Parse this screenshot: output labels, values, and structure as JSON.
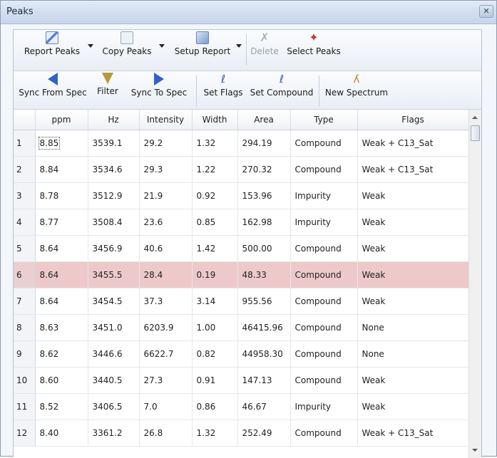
{
  "window": {
    "title": "Peaks"
  },
  "colors": {
    "selected_row": "#edc9c9",
    "accent": "#3a63c6"
  },
  "toolbar1": [
    {
      "label": "Report Peaks",
      "icon": "report-peaks-icon",
      "dropdown": true,
      "disabled": false
    },
    {
      "label": "Copy Peaks",
      "icon": "copy-peaks-icon",
      "dropdown": true,
      "disabled": false
    },
    {
      "label": "Setup Report",
      "icon": "setup-report-icon",
      "dropdown": true,
      "disabled": false
    },
    {
      "label": "Delete",
      "icon": "delete-icon",
      "dropdown": false,
      "disabled": true
    },
    {
      "label": "Select Peaks",
      "icon": "select-peaks-icon",
      "dropdown": false,
      "disabled": false
    }
  ],
  "toolbar2": [
    {
      "label": "Sync From Spec",
      "icon": "sync-from-spec-icon"
    },
    {
      "label": "Filter",
      "icon": "filter-icon"
    },
    {
      "label": "Sync To Spec",
      "icon": "sync-to-spec-icon"
    },
    {
      "label": "Set Flags",
      "icon": "set-flags-icon"
    },
    {
      "label": "Set Compound",
      "icon": "set-compound-icon"
    },
    {
      "label": "New Spectrum",
      "icon": "new-spectrum-icon"
    }
  ],
  "table": {
    "columns": [
      "",
      "ppm",
      "Hz",
      "Intensity",
      "Width",
      "Area",
      "Type",
      "Flags"
    ],
    "rows": [
      [
        "1",
        "8.85",
        "3539.1",
        "29.2",
        "1.32",
        "294.19",
        "Compound",
        "Weak + C13_Sat"
      ],
      [
        "2",
        "8.84",
        "3534.6",
        "29.3",
        "1.22",
        "270.32",
        "Compound",
        "Weak + C13_Sat"
      ],
      [
        "3",
        "8.78",
        "3512.9",
        "21.9",
        "0.92",
        "153.96",
        "Impurity",
        "Weak"
      ],
      [
        "4",
        "8.77",
        "3508.4",
        "23.6",
        "0.85",
        "162.98",
        "Impurity",
        "Weak"
      ],
      [
        "5",
        "8.64",
        "3456.9",
        "40.6",
        "1.42",
        "500.00",
        "Compound",
        "Weak"
      ],
      [
        "6",
        "8.64",
        "3455.5",
        "28.4",
        "0.19",
        "48.33",
        "Compound",
        "Weak"
      ],
      [
        "7",
        "8.64",
        "3454.5",
        "37.3",
        "3.14",
        "955.56",
        "Compound",
        "Weak"
      ],
      [
        "8",
        "8.63",
        "3451.0",
        "6203.9",
        "1.00",
        "46415.96",
        "Compound",
        "None"
      ],
      [
        "9",
        "8.62",
        "3446.6",
        "6622.7",
        "0.82",
        "44958.30",
        "Compound",
        "None"
      ],
      [
        "10",
        "8.60",
        "3440.5",
        "27.3",
        "0.91",
        "147.13",
        "Compound",
        "Weak"
      ],
      [
        "11",
        "8.52",
        "3406.5",
        "7.0",
        "0.86",
        "46.67",
        "Impurity",
        "Weak"
      ],
      [
        "12",
        "8.40",
        "3361.2",
        "26.8",
        "1.32",
        "252.49",
        "Compound",
        "Weak + C13_Sat"
      ]
    ],
    "selected_row": 6
  }
}
